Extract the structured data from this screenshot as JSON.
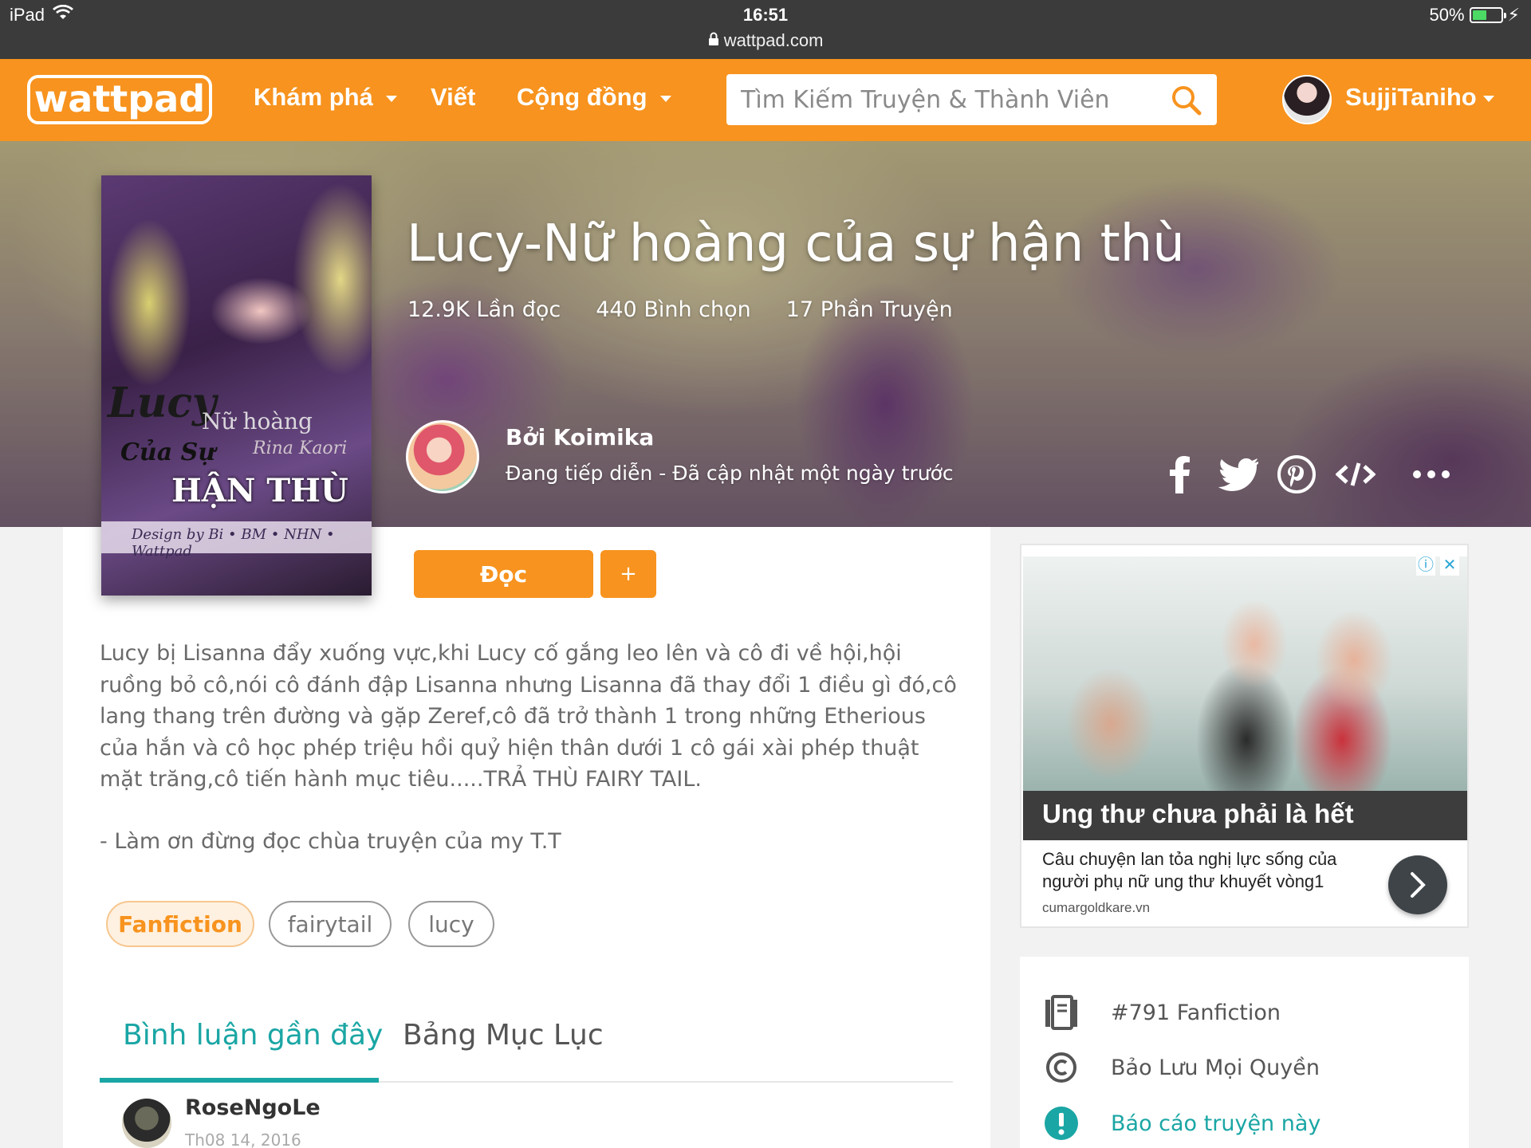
{
  "statusbar": {
    "device": "iPad",
    "time": "16:51",
    "url": "wattpad.com",
    "battery": "50%",
    "battery_level": 0.5
  },
  "header": {
    "logo": "wattpad",
    "nav": {
      "discover": "Khám phá",
      "write": "Viết",
      "community": "Cộng đồng"
    },
    "search_placeholder": "Tìm Kiếm Truyện & Thành Viên",
    "username": "SujjiTaniho"
  },
  "story": {
    "title": "Lucy-Nữ hoàng của sự hận thù",
    "reads": "12.9K Lần đọc",
    "votes": "440 Bình chọn",
    "parts": "17 Phần Truyện",
    "author": "Bởi Koimika",
    "status": "Đang tiếp diễn - Đã cập nhật một ngày trước",
    "cover": {
      "line1": "Lucy",
      "line2": "Nữ hoàng",
      "line3": "Của Sự",
      "line4": "Rina Kaori",
      "line5": "HẬN THÙ",
      "line6": "Design by Bi • BM • NHN • Wattpad"
    }
  },
  "actions": {
    "read": "Đọc",
    "add": "+"
  },
  "description": "Lucy bị Lisanna đẩy xuống vực,khi Lucy cố gắng leo lên và cô đi về hội,hội ruồng bỏ cô,nói cô đánh đập Lisanna nhưng Lisanna đã thay đổi 1 điều gì đó,cô lang thang trên đường và gặp Zeref,cô đã trở thành 1 trong những Etherious của hắn và cô học phép triệu hồi quỷ hiện thân dưới 1 cô gái xài phép thuật mặt trăng,cô tiến hành mục tiêu.....TRẢ THÙ FAIRY TAIL.",
  "note": "- Làm ơn đừng đọc chùa truyện của my T.T",
  "tags": [
    "Fanfiction",
    "fairytail",
    "lucy"
  ],
  "tabs": {
    "recent_comments": "Bình luận gần đây",
    "toc": "Bảng Mục Lục"
  },
  "comment": {
    "user": "RoseNgoLe",
    "date": "Th08 14, 2016"
  },
  "ad": {
    "headline": "Ung thư chưa phải là hết",
    "body": "Câu chuyện lan tỏa nghị lực sống của người phụ nữ ung thư khuyết vòng1",
    "domain": "cumargoldkare.vn",
    "info_glyph": "ⓘ",
    "close_glyph": "✕"
  },
  "info": {
    "rank": "#791 Fanfiction",
    "copyright": "Bảo Lưu Mọi Quyền",
    "report": "Báo cáo truyện này"
  },
  "colors": {
    "brand": "#f7931e",
    "teal": "#1aa6a4",
    "statusbar": "#3b3b3b"
  },
  "icons": [
    "wifi-icon",
    "lock-icon",
    "search-icon",
    "facebook-icon",
    "twitter-icon",
    "pinterest-icon",
    "embed-icon",
    "more-icon",
    "chevron-right-icon",
    "ranking-icon",
    "copyright-icon",
    "alert-icon"
  ]
}
